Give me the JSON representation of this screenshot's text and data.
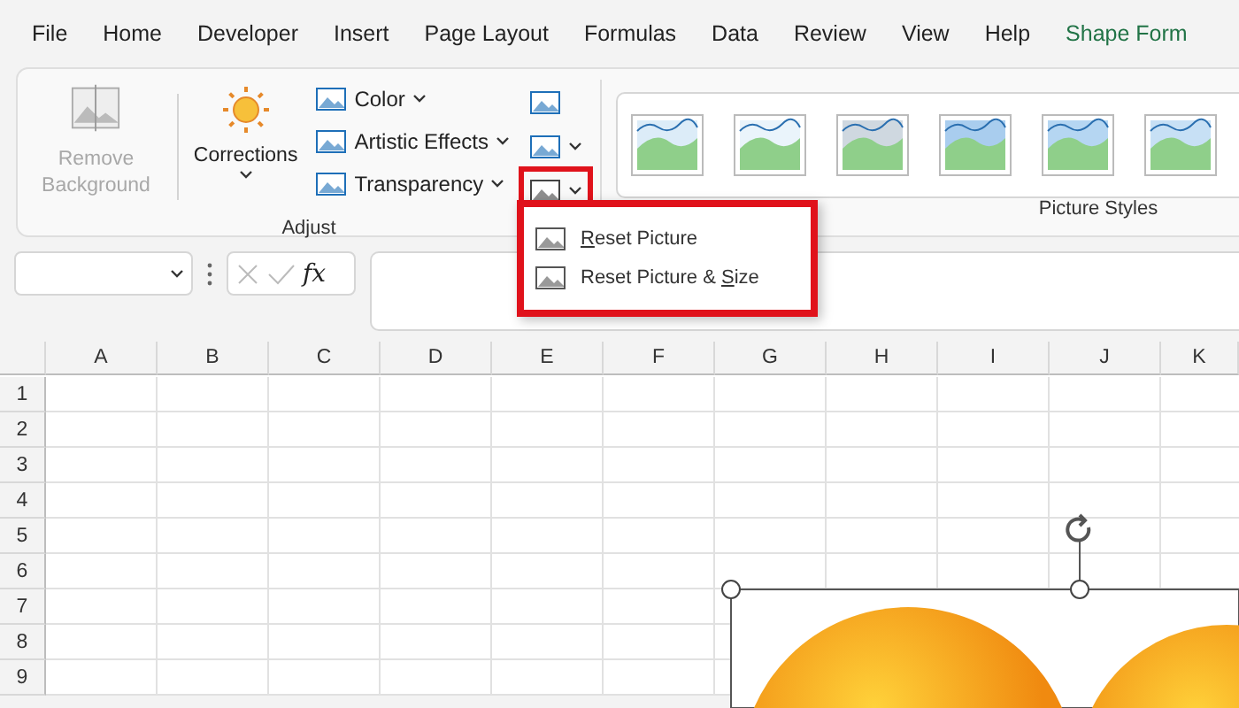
{
  "menu_tabs": [
    {
      "label": "File",
      "selected": false
    },
    {
      "label": "Home",
      "selected": false
    },
    {
      "label": "Developer",
      "selected": false
    },
    {
      "label": "Insert",
      "selected": false
    },
    {
      "label": "Page Layout",
      "selected": false
    },
    {
      "label": "Formulas",
      "selected": false
    },
    {
      "label": "Data",
      "selected": false
    },
    {
      "label": "Review",
      "selected": false
    },
    {
      "label": "View",
      "selected": false
    },
    {
      "label": "Help",
      "selected": false
    },
    {
      "label": "Shape Form",
      "selected": true
    }
  ],
  "adjust_group": {
    "label": "Adjust",
    "remove_background": {
      "label": "Remove Background",
      "disabled": true
    },
    "corrections": {
      "label": "Corrections"
    },
    "commands": [
      {
        "label": "Color"
      },
      {
        "label": "Artistic Effects"
      },
      {
        "label": "Transparency"
      }
    ]
  },
  "picture_styles_group": {
    "label": "Picture Styles"
  },
  "reset_menu": {
    "items": [
      {
        "segments": [
          {
            "text": "R",
            "underlined": true
          },
          {
            "text": "eset Picture",
            "underlined": false
          }
        ]
      },
      {
        "segments": [
          {
            "text": "Reset Picture & ",
            "underlined": false
          },
          {
            "text": "S",
            "underlined": true
          },
          {
            "text": "ize",
            "underlined": false
          }
        ]
      }
    ]
  },
  "formula_bar": {
    "fx": "fx"
  },
  "sheet": {
    "columns": [
      "A",
      "B",
      "C",
      "D",
      "E",
      "F",
      "G",
      "H",
      "I",
      "J",
      "K"
    ],
    "rows": [
      "1",
      "2",
      "3",
      "4",
      "5",
      "6",
      "7",
      "8",
      "9"
    ]
  }
}
